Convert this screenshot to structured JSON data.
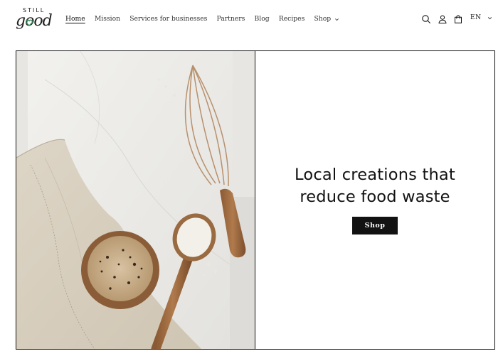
{
  "brand": {
    "logo_top": "STILL",
    "logo_main": "good"
  },
  "nav": {
    "items": [
      {
        "label": "Home",
        "active": true
      },
      {
        "label": "Mission"
      },
      {
        "label": "Services for businesses"
      },
      {
        "label": "Partners"
      },
      {
        "label": "Blog"
      },
      {
        "label": "Recipes"
      },
      {
        "label": "Shop",
        "has_dropdown": true
      }
    ]
  },
  "header_icons": {
    "search": "search-icon",
    "account": "account-icon",
    "cart": "cart-icon"
  },
  "language": {
    "selected": "EN"
  },
  "hero": {
    "title_line1": "Local creations that",
    "title_line2": "reduce food waste",
    "button_label": "Shop"
  },
  "colors": {
    "text": "#121212",
    "background": "#ffffff",
    "button_bg": "#121212",
    "logo_heart": "#3a8c5c"
  }
}
